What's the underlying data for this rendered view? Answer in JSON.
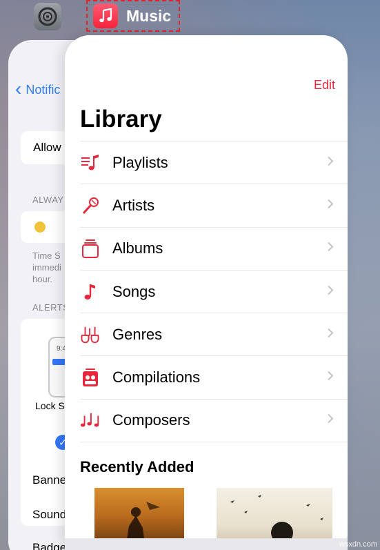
{
  "app_switcher": {
    "current_app": "Music"
  },
  "settings_card": {
    "back_label": "Notific",
    "allow_label": "Allow",
    "always_header": "ALWAY",
    "time_caption": [
      "Time S",
      "immedi",
      "hour."
    ],
    "alerts_header": "ALERTS",
    "preview_time": "9:4",
    "lock_label": "Lock S",
    "banner_label": "Banne",
    "sound_label": "Sound",
    "badge_label": "Badge"
  },
  "music": {
    "edit_label": "Edit",
    "library_title": "Library",
    "accent_color": "#e5283b",
    "items": [
      {
        "label": "Playlists",
        "icon": "playlists-icon"
      },
      {
        "label": "Artists",
        "icon": "microphone-icon"
      },
      {
        "label": "Albums",
        "icon": "albums-icon"
      },
      {
        "label": "Songs",
        "icon": "music-note-icon"
      },
      {
        "label": "Genres",
        "icon": "guitars-icon"
      },
      {
        "label": "Compilations",
        "icon": "compilation-icon"
      },
      {
        "label": "Composers",
        "icon": "composer-notes-icon"
      }
    ],
    "recently_added_title": "Recently Added"
  },
  "watermark": "wsxdn.com"
}
